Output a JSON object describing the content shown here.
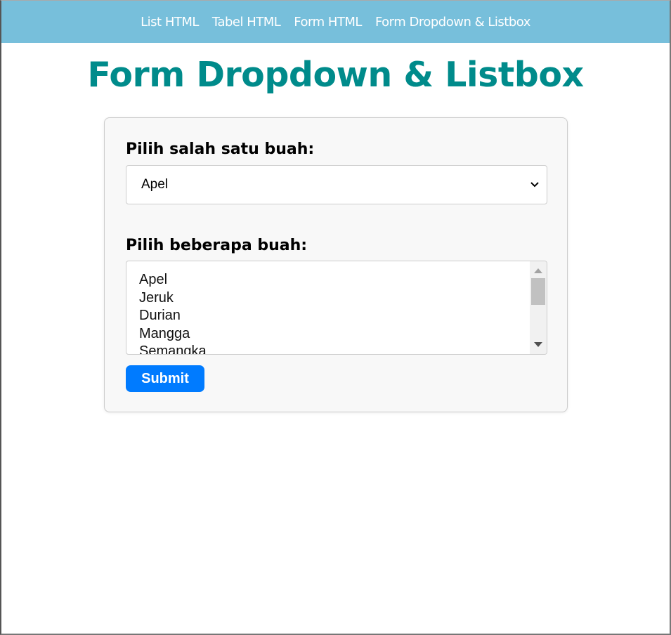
{
  "nav": {
    "items": [
      "List HTML",
      "Tabel HTML",
      "Form HTML",
      "Form Dropdown & Listbox"
    ]
  },
  "page_title": "Form Dropdown & Listbox",
  "form": {
    "dropdown_label": "Pilih salah satu buah:",
    "dropdown_value": "Apel",
    "listbox_label": "Pilih beberapa buah:",
    "listbox_options": [
      "Apel",
      "Jeruk",
      "Durian",
      "Mangga",
      "Semangka"
    ],
    "submit_label": "Submit"
  },
  "colors": {
    "nav_bg": "#77bfdb",
    "title": "#008b8b",
    "button": "#007bff"
  }
}
